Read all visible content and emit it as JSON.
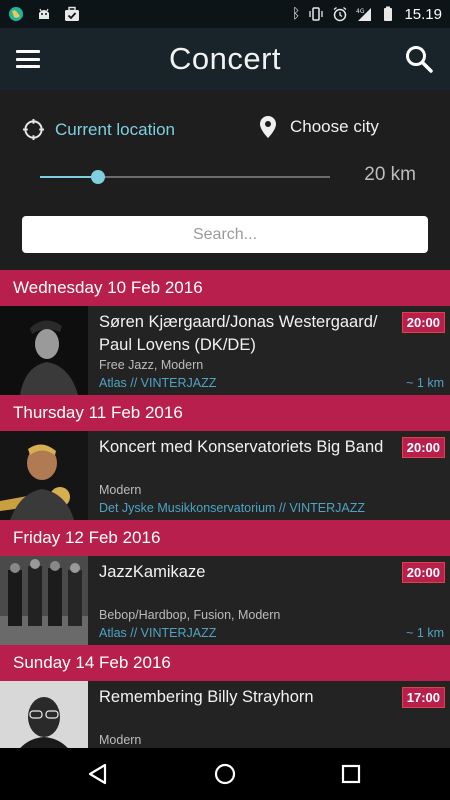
{
  "status_bar": {
    "time": "15.19",
    "network": "4G",
    "left_icons": [
      "globe-icon",
      "android-icon",
      "briefcase-check-icon"
    ],
    "right_icons": [
      "bluetooth-icon",
      "vibrate-icon",
      "alarm-icon",
      "signal-icon",
      "battery-icon"
    ]
  },
  "app_bar": {
    "title": "Concert",
    "menu_icon": "hamburger-icon",
    "search_icon": "search-icon"
  },
  "location": {
    "current_label": "Current location",
    "city_label": "Choose city",
    "slider_fraction": 0.2,
    "distance": "20 km",
    "search_placeholder": "Search..."
  },
  "days": [
    {
      "date": "Wednesday 10 Feb 2016",
      "events": [
        {
          "name": "Søren Kjærgaard/Jonas Westergaard/ Paul Lovens (DK/DE)",
          "genre": "Free Jazz, Modern",
          "venue": "Atlas // VINTERJAZZ",
          "distance": "~ 1 km",
          "time": "20:00"
        }
      ]
    },
    {
      "date": "Thursday 11 Feb 2016",
      "events": [
        {
          "name": "Koncert med Konservatoriets Big Band",
          "genre": "Modern",
          "venue": "Det Jyske Musikkonservatorium // VINTERJAZZ",
          "distance": "",
          "time": "20:00"
        }
      ]
    },
    {
      "date": "Friday 12 Feb 2016",
      "events": [
        {
          "name": "JazzKamikaze",
          "genre": "Bebop/Hardbop, Fusion, Modern",
          "venue": "Atlas // VINTERJAZZ",
          "distance": "~ 1 km",
          "time": "20:00"
        }
      ]
    },
    {
      "date": "Sunday 14 Feb 2016",
      "events": [
        {
          "name": "Remembering Billy Strayhorn",
          "genre": "Modern",
          "venue": "",
          "distance": "",
          "time": "17:00"
        }
      ]
    }
  ],
  "nav_bar": {
    "back_icon": "back-triangle-icon",
    "home_icon": "home-circle-icon",
    "recents_icon": "recents-square-icon"
  },
  "colors": {
    "accent": "#7ecfe0",
    "date_header": "#b81f4c",
    "venue_text": "#4ea4c4",
    "app_bar": "#19242a"
  }
}
